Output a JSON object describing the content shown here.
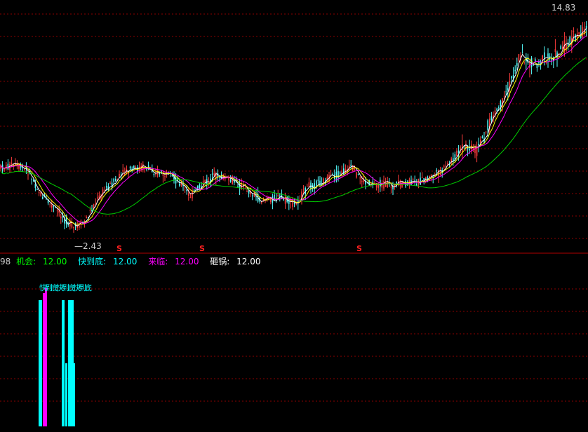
{
  "price_panel": {
    "high_label": "14.83",
    "low_label": "2.43",
    "signal_marker": "S",
    "signal_color": "#ff2020",
    "candle_up_color": "#ff3c3c",
    "candle_down_color": "#54ffff",
    "ma_colors": [
      "#ffffff",
      "#ffff00",
      "#ff00ff",
      "#00cc00"
    ]
  },
  "indicator_header": {
    "prefix": "98",
    "items": [
      {
        "label": "机会:",
        "value": "12.00",
        "color": "#00ff00"
      },
      {
        "label": "快到底:",
        "value": "12.00",
        "color": "#00ffff"
      },
      {
        "label": "来临:",
        "value": "12.00",
        "color": "#ff00ff"
      },
      {
        "label": "砸锅:",
        "value": "12.00",
        "color": "#ffffff"
      }
    ]
  },
  "indicator_panel": {
    "bar_color": "#00ffff",
    "accent_bar_color": "#ff00ff",
    "bar_labels_text": "快到底快到底快到底"
  },
  "colors": {
    "background": "#000000",
    "grid": "#8b0000",
    "divider": "#b00000"
  }
}
